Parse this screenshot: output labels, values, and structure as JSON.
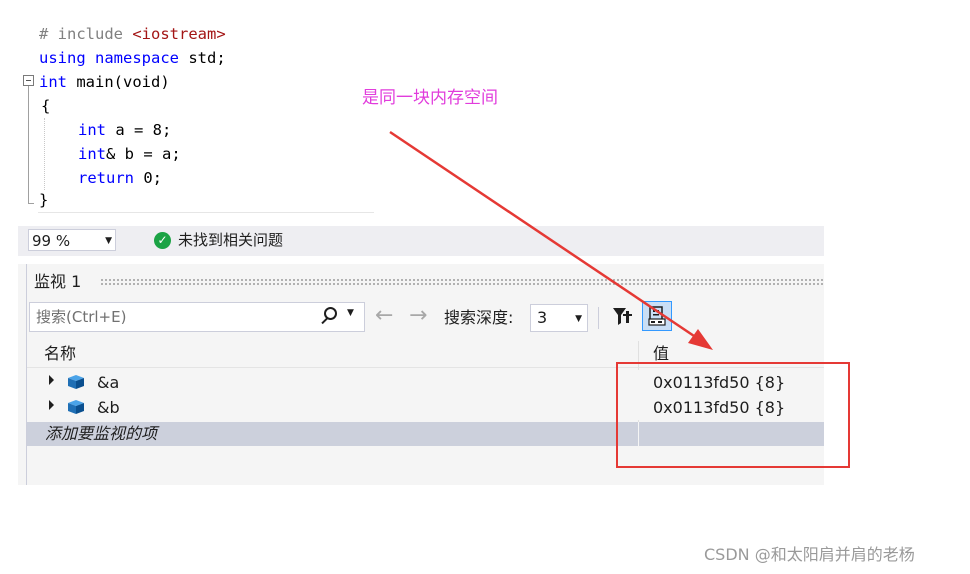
{
  "editor": {
    "lines": [
      {
        "a": "# include ",
        "b": "<iostream>"
      },
      {
        "kw1": "using",
        "mid": " ",
        "kw2": "namespace",
        "rest": " std;"
      },
      {
        "kw": "int",
        "rest": " main(void)"
      },
      {
        "text": "{"
      },
      {
        "kw": "int",
        "rest": " a = 8;"
      },
      {
        "kw": "int",
        "rest": "& b = a;"
      },
      {
        "kw": "return",
        "rest": " 0;"
      },
      {
        "text": "}"
      }
    ]
  },
  "status": {
    "zoom": "99 %",
    "no_issues": "未找到相关问题"
  },
  "watch": {
    "title": "监视 1",
    "search_placeholder": "搜索(Ctrl+E)",
    "depth_label": "搜索深度:",
    "depth_value": "3",
    "columns": {
      "name": "名称",
      "value": "值"
    },
    "rows": [
      {
        "name": "&a",
        "value": "0x0113fd50 {8}"
      },
      {
        "name": "&b",
        "value": "0x0113fd50 {8}"
      }
    ],
    "add_item": "添加要监视的项"
  },
  "annotation": {
    "text": "是同一块内存空间",
    "color": "#e13cdc",
    "box_color": "#e53935"
  },
  "watermark": "CSDN @和太阳肩并肩的老杨"
}
